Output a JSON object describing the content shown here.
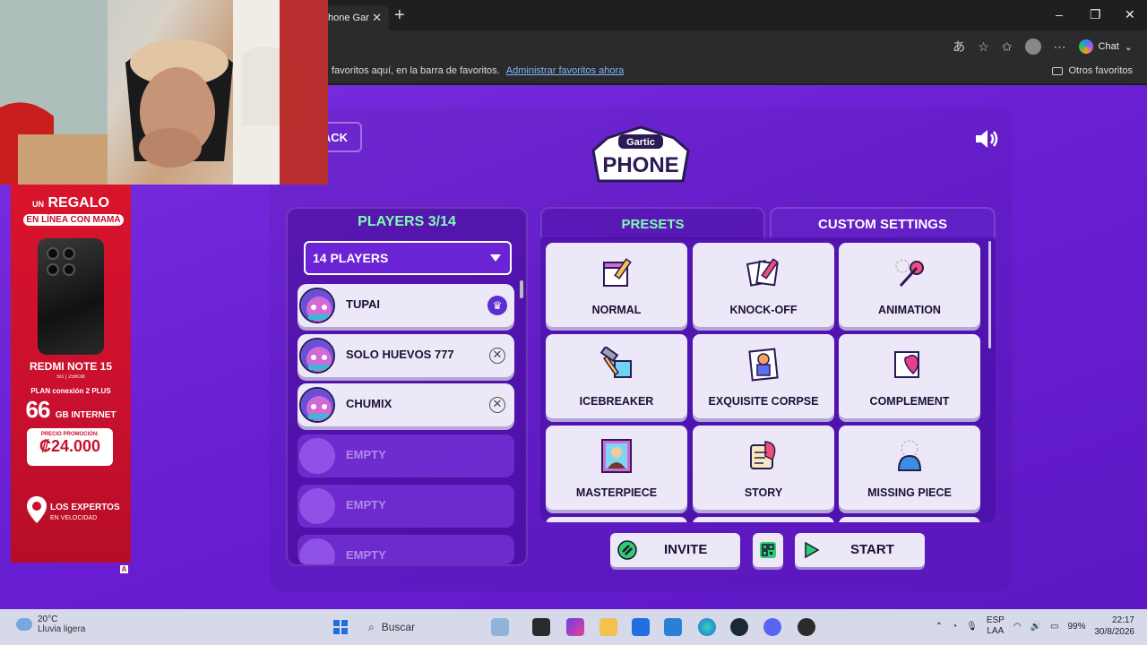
{
  "browser": {
    "tab_title": "hone Gar",
    "chat_label": "Chat",
    "favbar_text": "favoritos aquí, en la barra de favoritos.",
    "favbar_link": "Administrar favoritos ahora",
    "other_favorites": "Otros favoritos"
  },
  "game": {
    "back_label": "ACK",
    "logo_top": "Gartic",
    "logo_bottom": "PHONE",
    "players": {
      "title": "PLAYERS 3/14",
      "select_value": "14 PLAYERS",
      "slots": [
        {
          "name": "TUPAI",
          "status": "host"
        },
        {
          "name": "SOLO HUEVOS 777",
          "status": "kick"
        },
        {
          "name": "CHUMIX",
          "status": "kick"
        },
        {
          "name": "EMPTY",
          "status": "empty"
        },
        {
          "name": "EMPTY",
          "status": "empty"
        },
        {
          "name": "EMPTY",
          "status": "empty"
        }
      ]
    },
    "tabs": {
      "presets": "PRESETS",
      "custom": "CUSTOM SETTINGS"
    },
    "presets": [
      {
        "label": "NORMAL",
        "icon": "notepad-pencil-icon"
      },
      {
        "label": "KNOCK-OFF",
        "icon": "cards-pencil-icon"
      },
      {
        "label": "ANIMATION",
        "icon": "animation-icon"
      },
      {
        "label": "ICEBREAKER",
        "icon": "ice-hammer-icon"
      },
      {
        "label": "EXQUISITE CORPSE",
        "icon": "exquisite-corpse-icon"
      },
      {
        "label": "COMPLEMENT",
        "icon": "complement-icon"
      },
      {
        "label": "MASTERPIECE",
        "icon": "masterpiece-icon"
      },
      {
        "label": "STORY",
        "icon": "scroll-feather-icon"
      },
      {
        "label": "MISSING PIECE",
        "icon": "missing-piece-icon"
      }
    ],
    "buttons": {
      "invite": "INVITE",
      "start": "START"
    }
  },
  "ad": {
    "line1_prefix": "UN",
    "line1": "REGALO",
    "line2": "EN LÍNEA CON MAMÁ",
    "model": "REDMI NOTE 15",
    "spec": "5G | 256GB",
    "plan": "PLAN conexión 2 PLUS",
    "gb": "66",
    "gb_unit": "GB INTERNET",
    "price_label": "PRECIO PROMOCIÓN:",
    "price": "₡24.000",
    "experts": "LOS EXPERTOS",
    "experts_sub": "EN VELOCIDAD",
    "badge": "A"
  },
  "taskbar": {
    "temp": "20°C",
    "weather": "Lluvia ligera",
    "search_placeholder": "Buscar",
    "lang": "ESP",
    "lang_sub": "LAA",
    "battery": "99%",
    "time": "22:17",
    "date": "30/8/2026"
  },
  "colors": {
    "accent_green": "#7dffb0",
    "game_purple": "#6a1fd3",
    "ad_red": "#c8102e"
  }
}
